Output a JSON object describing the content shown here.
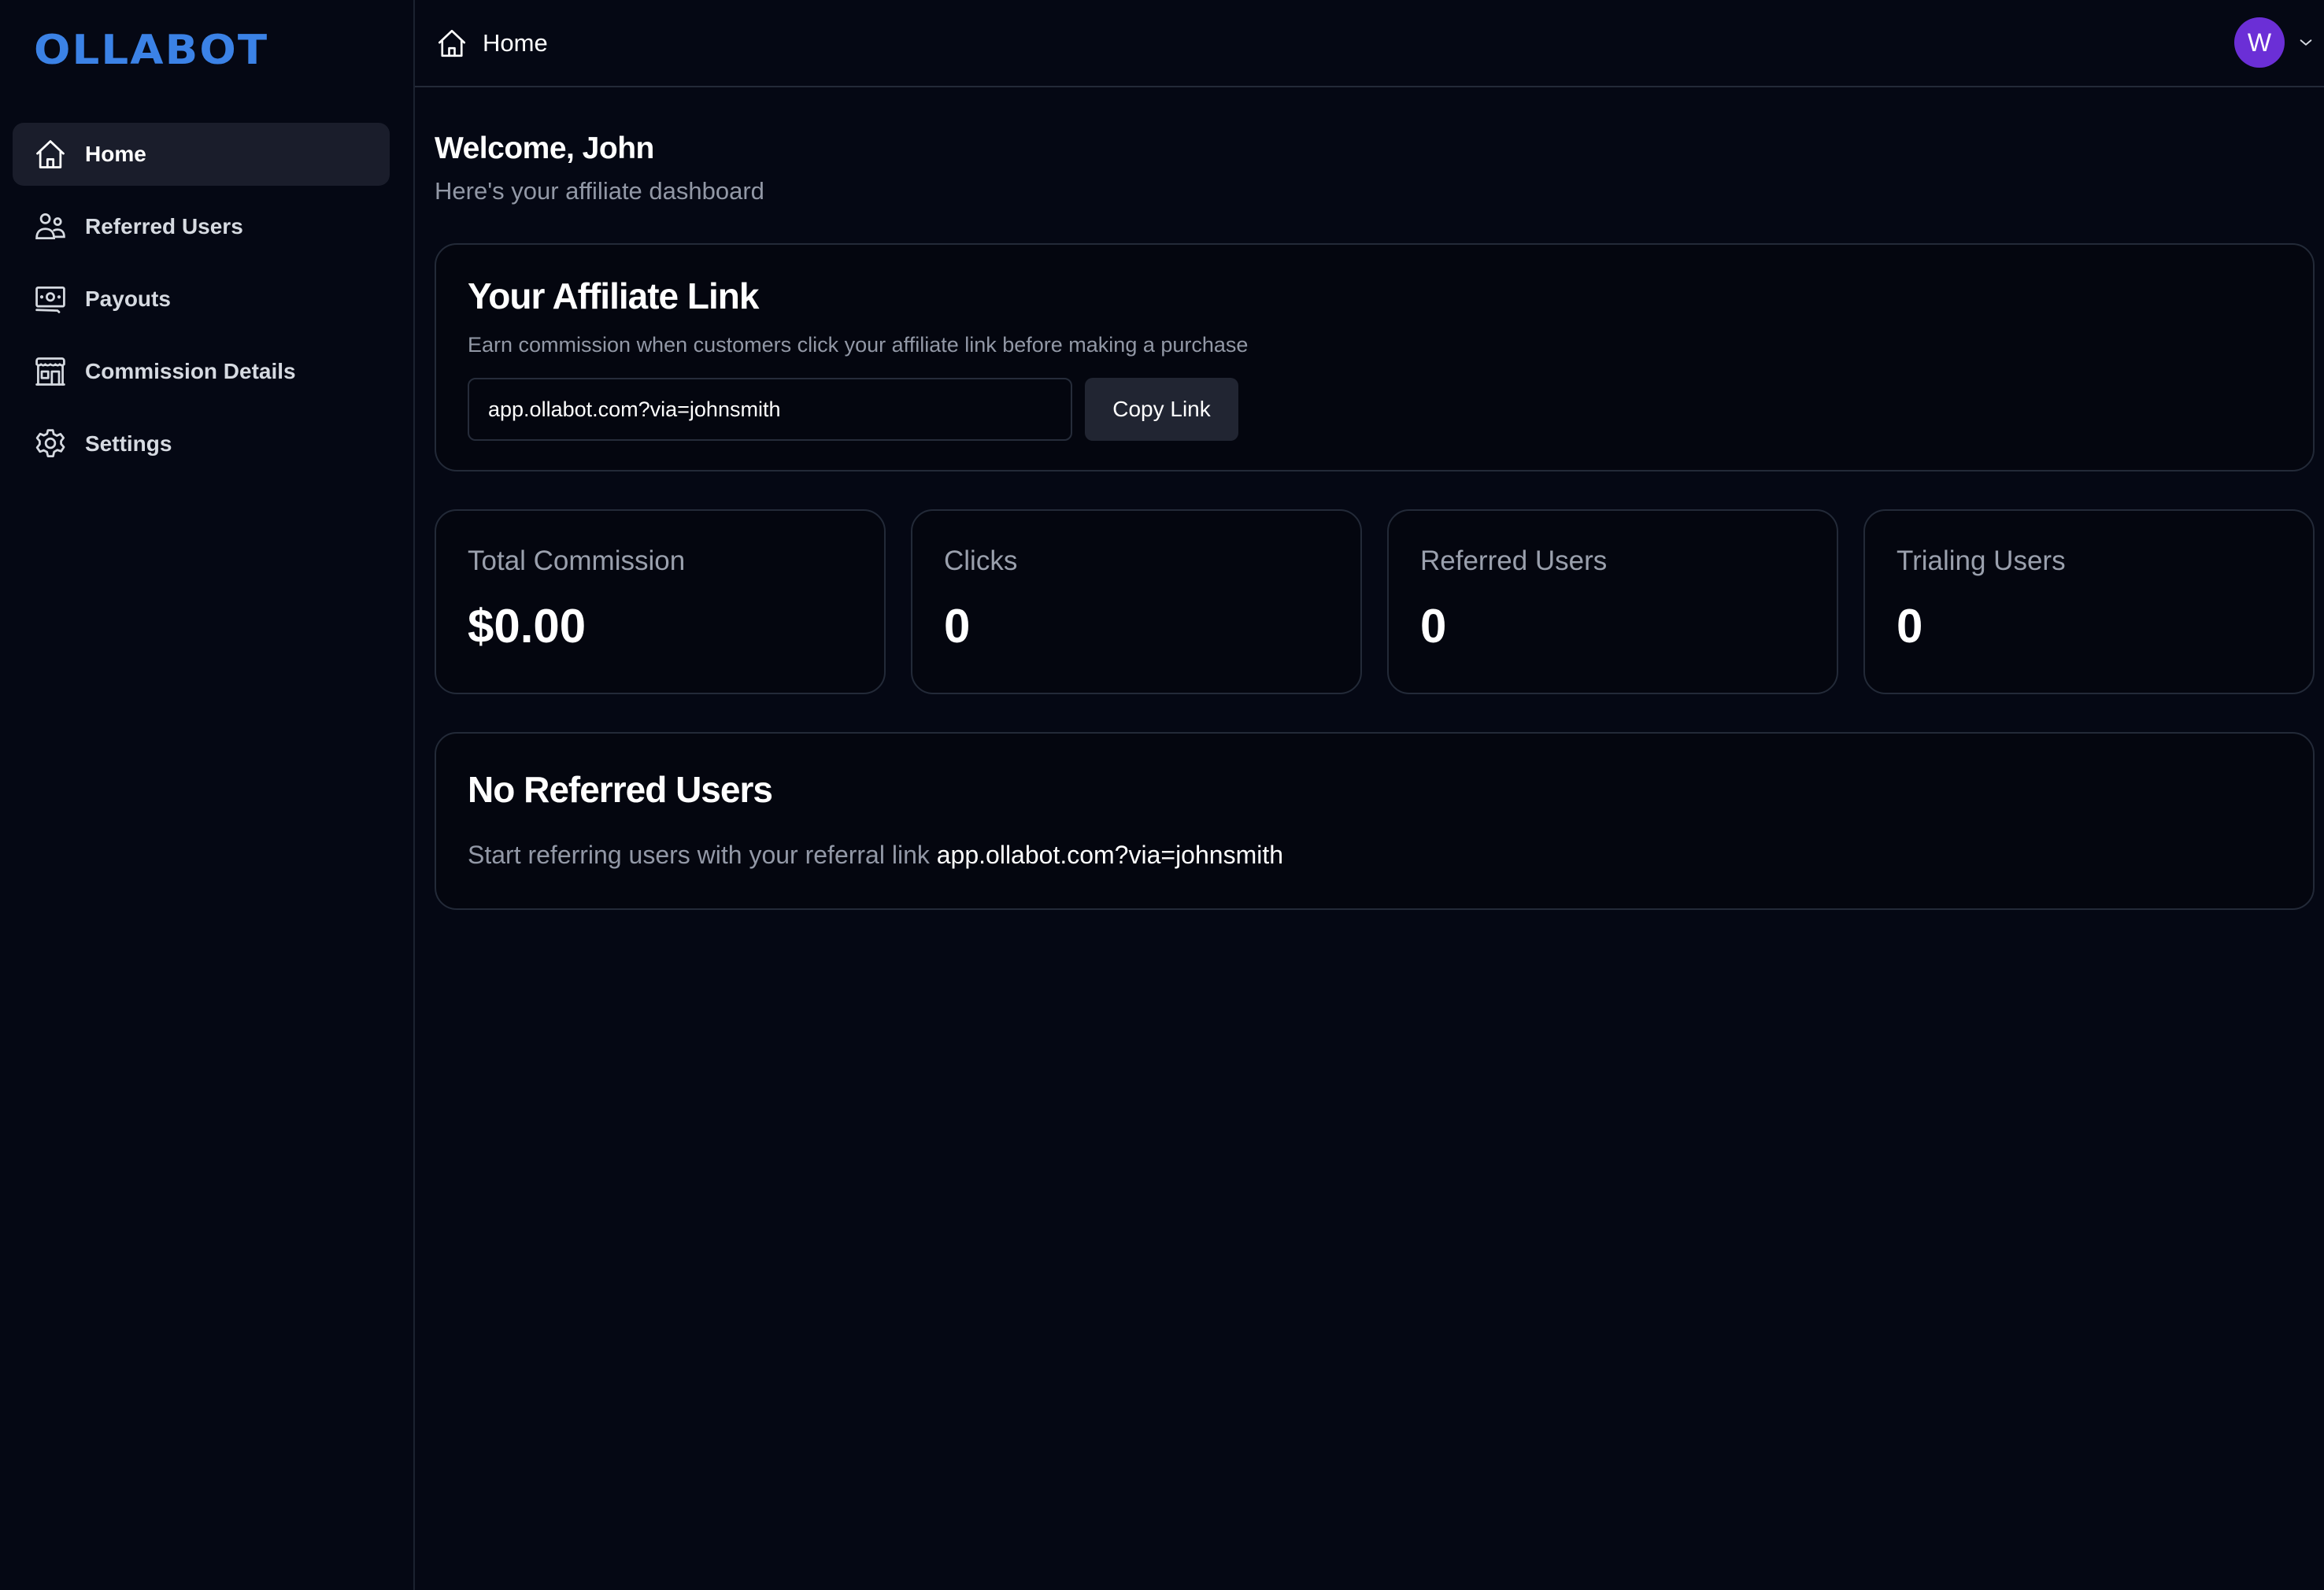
{
  "app": {
    "logo": "OLLABOT",
    "brand_color": "#3b82e6"
  },
  "sidebar": {
    "items": [
      {
        "label": "Home",
        "icon": "home-icon",
        "active": true
      },
      {
        "label": "Referred Users",
        "icon": "users-icon",
        "active": false
      },
      {
        "label": "Payouts",
        "icon": "banknote-icon",
        "active": false
      },
      {
        "label": "Commission Details",
        "icon": "storefront-icon",
        "active": false
      },
      {
        "label": "Settings",
        "icon": "gear-icon",
        "active": false
      }
    ]
  },
  "header": {
    "breadcrumb": "Home",
    "breadcrumb_icon": "home-icon",
    "avatar_initial": "W",
    "avatar_color": "#6b2fd6"
  },
  "welcome": {
    "title": "Welcome, John",
    "subtitle": "Here's your affiliate dashboard"
  },
  "affiliate_link": {
    "title": "Your Affiliate Link",
    "description": "Earn commission when customers click your affiliate link before making a purchase",
    "link_value": "app.ollabot.com?via=johnsmith",
    "copy_label": "Copy Link"
  },
  "stats": [
    {
      "label": "Total Commission",
      "value": "$0.00"
    },
    {
      "label": "Clicks",
      "value": "0"
    },
    {
      "label": "Referred Users",
      "value": "0"
    },
    {
      "label": "Trialing Users",
      "value": "0"
    }
  ],
  "referred_users": {
    "empty_title": "No Referred Users",
    "empty_text": "Start referring users with your referral link",
    "link": "app.ollabot.com?via=johnsmith"
  }
}
